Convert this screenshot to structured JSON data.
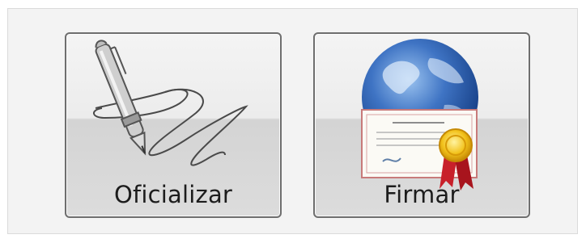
{
  "actions": {
    "oficializar": {
      "label": "Oficializar",
      "icon": "signature-pen-icon"
    },
    "firmar": {
      "label": "Firmar",
      "icon": "globe-certificate-icon"
    }
  },
  "colors": {
    "panel_bg": "#f3f3f3",
    "button_border": "#6e6e6e",
    "ribbon_red": "#c8202a",
    "seal_gold": "#f2c21b",
    "globe_blue": "#2b5fb0"
  }
}
